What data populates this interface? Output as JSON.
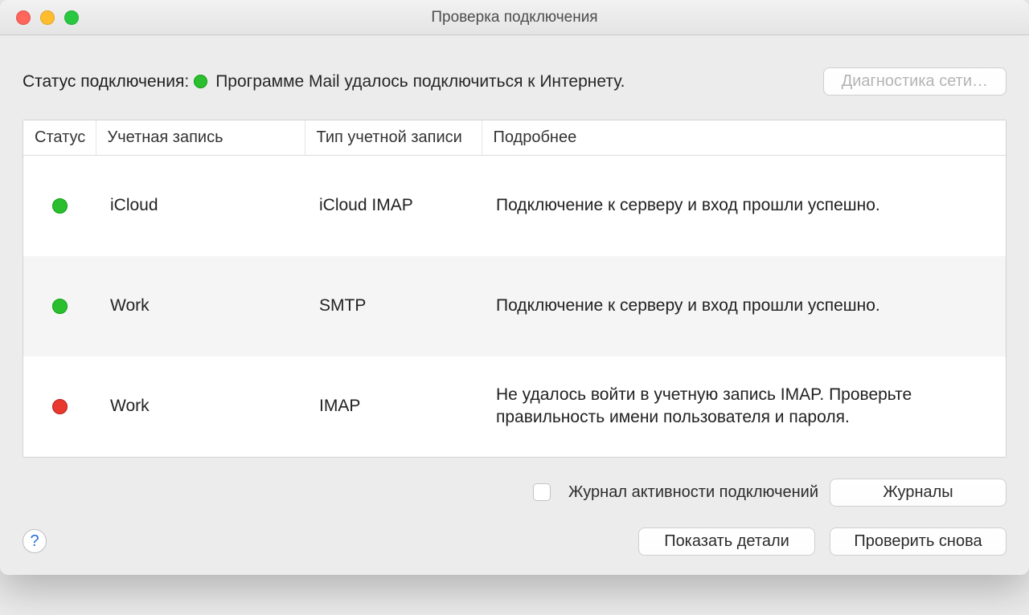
{
  "window": {
    "title": "Проверка подключения"
  },
  "status": {
    "label": "Статус подключения:",
    "message": "Программе Mail удалось подключиться к Интернету.",
    "color_ok": "#2bbf2f",
    "color_err": "#e8392e"
  },
  "buttons": {
    "diagnostics": "Диагностика сети…",
    "logs": "Журналы",
    "show_details": "Показать детали",
    "check_again": "Проверить снова"
  },
  "checkbox": {
    "activity_log": "Журнал активности подключений"
  },
  "table": {
    "headers": {
      "status": "Статус",
      "account": "Учетная запись",
      "type": "Тип учетной записи",
      "details": "Подробнее"
    },
    "rows": [
      {
        "status": "ok",
        "account": "iCloud",
        "type": "iCloud IMAP",
        "details": "Подключение к серверу и вход прошли успешно."
      },
      {
        "status": "ok",
        "account": "Work",
        "type": "SMTP",
        "details": "Подключение к серверу и вход прошли успешно."
      },
      {
        "status": "err",
        "account": "Work",
        "type": "IMAP",
        "details": "Не удалось войти в учетную запись IMAP. Проверьте правильность имени пользователя и пароля."
      }
    ]
  },
  "help": {
    "glyph": "?"
  }
}
